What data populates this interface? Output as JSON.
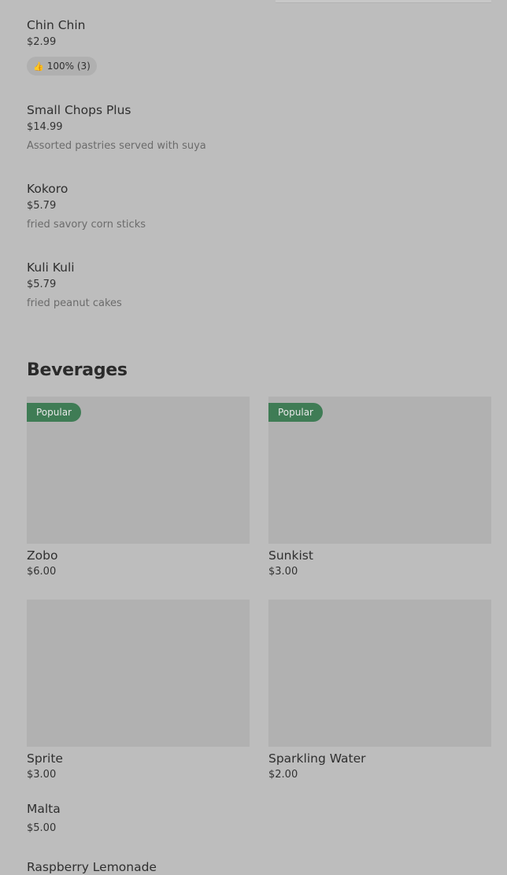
{
  "menu_items": [
    {
      "name": "Chin Chin",
      "price": "$2.99",
      "rating": "100% (3)"
    },
    {
      "name": "Small Chops Plus",
      "price": "$14.99",
      "description": "Assorted pastries served with suya"
    },
    {
      "name": "Kokoro",
      "price": "$5.79",
      "description": "fried savory corn sticks"
    },
    {
      "name": "Kuli Kuli",
      "price": "$5.79",
      "description": "fried peanut cakes"
    }
  ],
  "section": {
    "title": "Beverages"
  },
  "beverages": [
    {
      "name": "Zobo",
      "price": "$6.00",
      "badge": "Popular"
    },
    {
      "name": "Sunkist",
      "price": "$3.00",
      "badge": "Popular"
    },
    {
      "name": "Sprite",
      "price": "$3.00"
    },
    {
      "name": "Sparkling Water",
      "price": "$2.00"
    },
    {
      "name": "Malta",
      "price": "$5.00"
    },
    {
      "name": "Raspberry Lemonade"
    }
  ],
  "icons": {
    "rating": "thumbs-up-icon"
  },
  "colors": {
    "popular_badge": "#3f7c55",
    "background": "#bdbdbd",
    "placeholder": "#b1b1b1"
  }
}
